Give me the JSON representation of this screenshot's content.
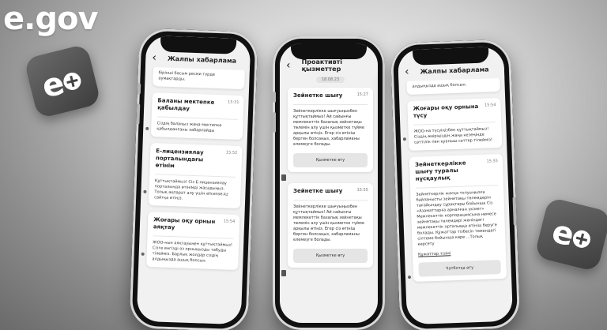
{
  "logo": {
    "text": "e.gov"
  },
  "phones": [
    {
      "header": "Жалпы хабарлама",
      "cards": [
        {
          "body": "бірінші басым ресми түрде аумақтарды."
        },
        {
          "title": "Баланы мектепке қабылдау",
          "time": "15:31",
          "body": "Сіздің балаңыз жаңа мектепке қабылданғаны хабарлайды"
        },
        {
          "title": "Е-лицензиялау порталындағы өтінім",
          "time": "15:52",
          "body": "Құттықтаймыз! Сіз Е-лицензиялау порталында өтінімді жасадыңыз. Толық ақпарат алу үшін elicense.kz сайтқа өтіңіз."
        },
        {
          "title": "Жоғары оқу орнын аяқтау",
          "time": "15:54",
          "body": "ЖОО-нын аяқтауыңен құттықтаймыз! Сізге енгізді оз орныңызды табуды тілейміз. Барлық жолдар сіздің алдыңызда ашық болсын."
        }
      ]
    },
    {
      "header": "Проактивті қызметтер",
      "date": "18.08.23",
      "cards": [
        {
          "title": "Зейнетке шығу",
          "time": "15:27",
          "body": "Зейнеткерлікке шығуыңызбен құттықтаймыз! Ай сайынғы мемлекеттік базалық зейнетақы төлемін алу үшін қызметке түйме арқылы өтіңіз. Егер сіз өтініш берген болсаңыз, хабарламаны елемеуге болады.",
          "button": "Қызметке өту"
        },
        {
          "title": "Зейнетке шығу",
          "time": "15:55",
          "body": "Зейнеткерлікке шығуыңызбен құттықтаймыз! Ай сайынғы мемлекеттік базалық зейнетақы төлемін алу үшін қызметке түйме арқылы өтіңіз. Егер сіз өтініш берген болсаңыз, хабарламаны елемеуге болады.",
          "button": "Қызметке өту"
        }
      ]
    },
    {
      "header": "Жалпы хабарлама",
      "cards": [
        {
          "body": "алдыңызда ашық болсын."
        },
        {
          "title": "Жоғары оқу орнына түсу",
          "time": "15:54",
          "body": "ЖОО-на түсуіңізбен құттықтаймыз! Сіздің өміріңіздің жаңа кезеңінде сәттілік пен қуаныш сәттер тілейміз!"
        },
        {
          "title": "Зейнеткерлікке шығу туралы нұсқаулық",
          "time": "15:55",
          "body": "Зейнеткерлік жасқа толуыңызға байланысты зейнетақы төлемдерін тағайындау сұрақтары бойынша Сіз «Азаматтарға арналған үкімет» Мемлекеттік корпорациясына немесе зейнетақы төлемдері жөніндегі мемлекеттік орталыққа өтініш беруге болады. Құжаттар тізбесін төмендегі сілтеме бойынша көре ...Толық көрсету",
          "link": "Құжаттар тізімі",
          "button": "Чатботқа өту"
        }
      ]
    }
  ]
}
